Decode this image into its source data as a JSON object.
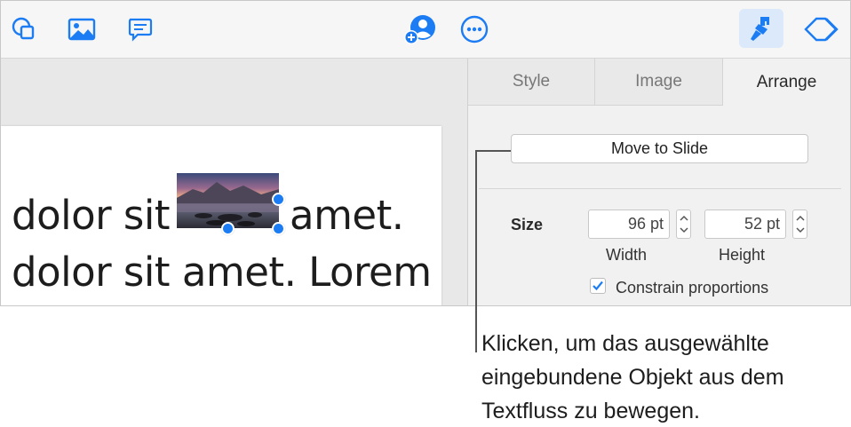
{
  "toolbar": {
    "icons": [
      "shape-icon",
      "media-icon",
      "comment-icon",
      "collaborate-icon",
      "more-icon",
      "format-icon",
      "animate-icon"
    ],
    "accent_color": "#1b7cf4",
    "active_button_bg": "#dbe9fb"
  },
  "slide": {
    "line1_before": "dolor sit ",
    "line1_after": "amet.",
    "line2": "dolor sit amet. Lorem"
  },
  "inspector": {
    "tabs": [
      {
        "label": "Style",
        "active": false
      },
      {
        "label": "Image",
        "active": false
      },
      {
        "label": "Arrange",
        "active": true
      }
    ],
    "move_button_label": "Move to Slide",
    "size_label": "Size",
    "width_value": "96 pt",
    "height_value": "52 pt",
    "width_caption": "Width",
    "height_caption": "Height",
    "constrain_label": "Constrain proportions",
    "constrain_checked": true
  },
  "callout": {
    "line1": "Klicken, um das ausgewählte",
    "line2": "eingebundene Objekt aus dem",
    "line3": "Textfluss zu bewegen."
  }
}
